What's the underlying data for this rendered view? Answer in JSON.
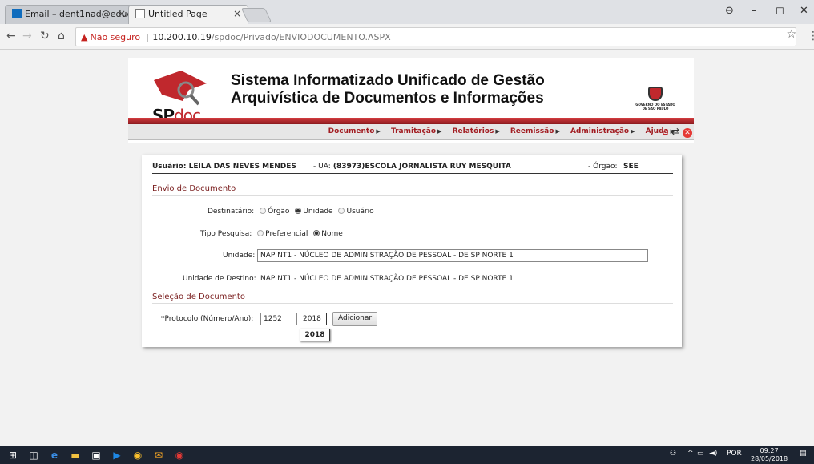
{
  "browser": {
    "tabs": [
      {
        "title": "Email – dent1nad@educ",
        "active": false
      },
      {
        "title": "Untitled Page",
        "active": true
      }
    ],
    "tab_close": "×",
    "address": {
      "insecure_label": "Não seguro",
      "separator": "|",
      "host": "10.200.10.19",
      "path": "/spdoc/Privado/ENVIODOCUMENTO.ASPX"
    }
  },
  "header": {
    "logo_sp": "SP",
    "logo_doc": "doc",
    "title_line1": "Sistema Informatizado Unificado de Gestão",
    "title_line2": "Arquivística de Documentos e Informações",
    "gov_text": "GOVERNO DO ESTADO DE SÃO PAULO"
  },
  "menu": {
    "items": [
      "Documento",
      "Tramitação",
      "Relatórios",
      "Reemissão",
      "Administração",
      "Ajuda"
    ],
    "arrow": "▶"
  },
  "user_info": {
    "usuario_label": "Usuário:",
    "usuario": "LEILA DAS NEVES MENDES",
    "ua_label": "- UA:",
    "ua": "(83973)ESCOLA JORNALISTA RUY MESQUITA",
    "orgao_label": "- Órgão:",
    "orgao": "SEE"
  },
  "form": {
    "section1": "Envio de Documento",
    "destinatario_label": "Destinatário:",
    "destinatario_options": [
      "Órgão",
      "Unidade",
      "Usuário"
    ],
    "destinatario_selected": "Unidade",
    "tipo_label": "Tipo Pesquisa:",
    "tipo_options": [
      "Preferencial",
      "Nome"
    ],
    "tipo_selected": "Nome",
    "unidade_label": "Unidade:",
    "unidade_value": "NAP NT1 - NÚCLEO DE ADMINISTRAÇÃO DE PESSOAL - DE SP NORTE 1",
    "destino_label": "Unidade de Destino:",
    "destino_value": "NAP NT1 - NÚCLEO DE ADMINISTRAÇÃO DE PESSOAL - DE SP NORTE 1",
    "section2": "Seleção de Documento",
    "protocolo_label": "*Protocolo (Número/Ano):",
    "protocolo_numero": "1252",
    "protocolo_ano": "2018",
    "adicionar_label": "Adicionar",
    "autocomplete_suggestion": "2018"
  },
  "taskbar": {
    "language": "POR",
    "time": "09:27",
    "date": "28/05/2018"
  }
}
